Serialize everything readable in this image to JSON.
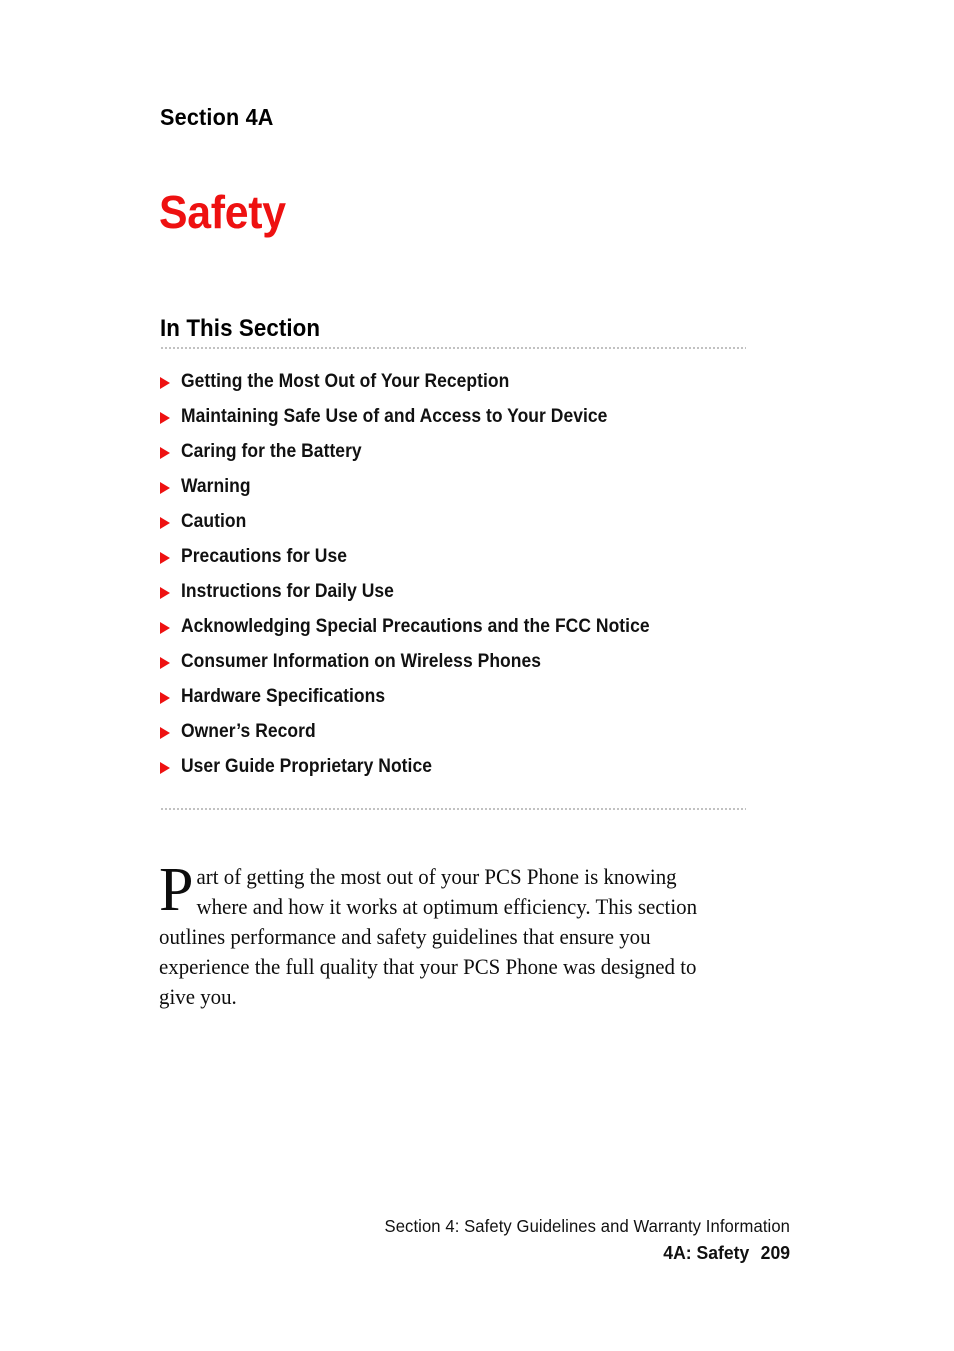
{
  "document": {
    "section_label": "Section 4A",
    "title": "Safety",
    "title_color": "#ee1111",
    "in_this_section_heading": "In This Section",
    "toc": [
      {
        "label": "Getting the Most Out of Your Reception"
      },
      {
        "label": "Maintaining Safe Use of and Access to Your Device"
      },
      {
        "label": "Caring for the Battery"
      },
      {
        "label": "Warning"
      },
      {
        "label": "Caution"
      },
      {
        "label": "Precautions for Use"
      },
      {
        "label": "Instructions for Daily Use"
      },
      {
        "label": "Acknowledging Special Precautions and the FCC Notice"
      },
      {
        "label": "Consumer Information on Wireless Phones"
      },
      {
        "label": "Hardware Specifications"
      },
      {
        "label": "Owner’s Record"
      },
      {
        "label": "User Guide Proprietary Notice"
      }
    ],
    "intro": {
      "dropcap": "P",
      "body": "art of getting the most out of your PCS Phone is knowing where and how it works at optimum efficiency. This section outlines performance and safety guidelines that ensure you experience the full quality that your PCS Phone was designed to give you."
    },
    "footer": {
      "line1": "Section 4: Safety Guidelines and Warranty Information",
      "line2": "4A: Safety",
      "page_number": "209"
    }
  }
}
